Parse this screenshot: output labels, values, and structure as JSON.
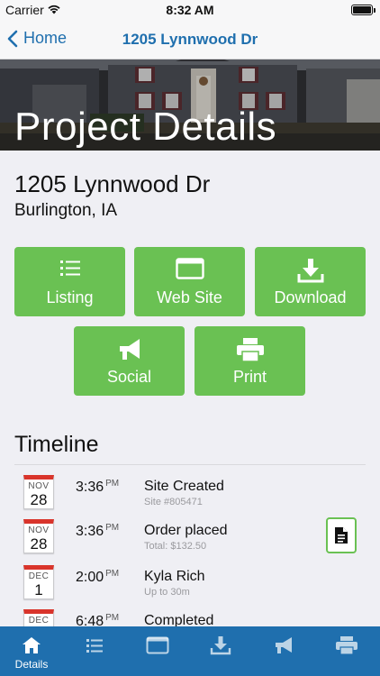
{
  "status_bar": {
    "carrier": "Carrier",
    "time": "8:32 AM"
  },
  "nav": {
    "back_label": "Home",
    "title": "1205 Lynnwood Dr"
  },
  "hero": {
    "title": "Project Details"
  },
  "property": {
    "address": "1205 Lynnwood Dr",
    "city": "Burlington, IA"
  },
  "actions": [
    {
      "label": "Listing",
      "icon": "list-icon"
    },
    {
      "label": "Web Site",
      "icon": "browser-window-icon"
    },
    {
      "label": "Download",
      "icon": "download-icon"
    },
    {
      "label": "Social",
      "icon": "megaphone-icon"
    },
    {
      "label": "Print",
      "icon": "printer-icon"
    }
  ],
  "timeline": {
    "heading": "Timeline",
    "items": [
      {
        "month": "NOV",
        "day": "28",
        "time": "3:36",
        "ampm": "PM",
        "title": "Site Created",
        "subtitle": "Site #805471",
        "has_doc": false
      },
      {
        "month": "NOV",
        "day": "28",
        "time": "3:36",
        "ampm": "PM",
        "title": "Order placed",
        "subtitle": "Total: $132.50",
        "has_doc": true
      },
      {
        "month": "DEC",
        "day": "1",
        "time": "2:00",
        "ampm": "PM",
        "title": "Kyla Rich",
        "subtitle": "Up to 30m",
        "has_doc": false
      },
      {
        "month": "DEC",
        "day": "",
        "time": "6:48",
        "ampm": "PM",
        "title": "Completed",
        "subtitle": "",
        "has_doc": false
      }
    ]
  },
  "tab_bar": {
    "tabs": [
      {
        "label": "Details",
        "icon": "home-icon",
        "active": true
      },
      {
        "label": "",
        "icon": "list-icon",
        "active": false
      },
      {
        "label": "",
        "icon": "browser-window-icon",
        "active": false
      },
      {
        "label": "",
        "icon": "download-icon",
        "active": false
      },
      {
        "label": "",
        "icon": "megaphone-icon",
        "active": false
      },
      {
        "label": "",
        "icon": "printer-icon",
        "active": false
      }
    ]
  },
  "colors": {
    "accent_blue": "#1f6fae",
    "action_green": "#6ac153",
    "calendar_red": "#d9342b",
    "background": "#efeff4"
  }
}
